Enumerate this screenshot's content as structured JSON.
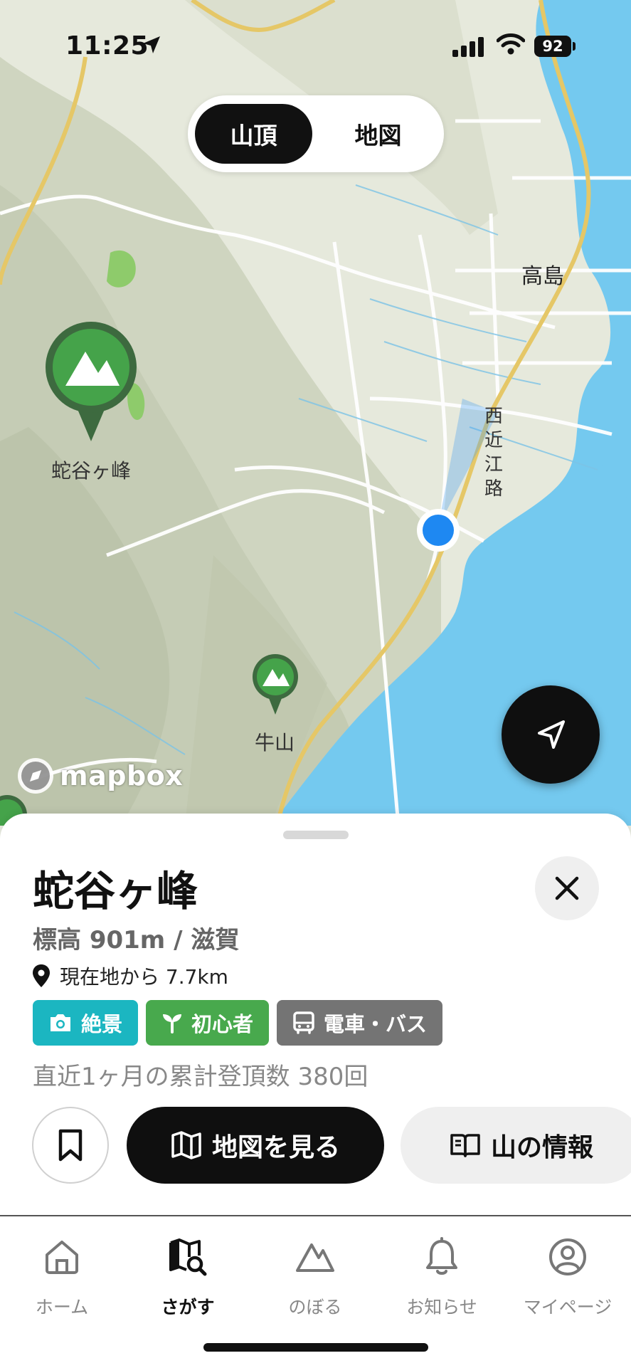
{
  "status": {
    "time": "11:25",
    "battery": "92"
  },
  "segmented": {
    "active": "山頂",
    "inactive": "地図"
  },
  "map": {
    "places": [
      "高島"
    ],
    "road_label": "西近江路",
    "pins": [
      {
        "label": "蛇谷ヶ峰"
      },
      {
        "label": "牛山"
      }
    ],
    "attribution": "mapbox"
  },
  "sheet": {
    "title": "蛇谷ヶ峰",
    "elevation": "標高 901m / 滋賀",
    "distance": "現在地から 7.7km",
    "tags": [
      {
        "label": "絶景",
        "color": "#1bb6c1",
        "icon": "camera-icon"
      },
      {
        "label": "初心者",
        "color": "#48a94d",
        "icon": "sprout-icon"
      },
      {
        "label": "電車・バス",
        "color": "#747474",
        "icon": "bus-icon"
      }
    ],
    "summit_count": "直近1ヶ月の累計登頂数 380回",
    "view_map_button": "地図を見る",
    "mountain_info_button": "山の情報"
  },
  "tabbar": {
    "items": [
      {
        "label": "ホーム",
        "icon": "home-icon"
      },
      {
        "label": "さがす",
        "icon": "map-search-icon",
        "active": true
      },
      {
        "label": "のぼる",
        "icon": "mountain-icon"
      },
      {
        "label": "お知らせ",
        "icon": "bell-icon"
      },
      {
        "label": "マイページ",
        "icon": "user-icon"
      }
    ]
  }
}
